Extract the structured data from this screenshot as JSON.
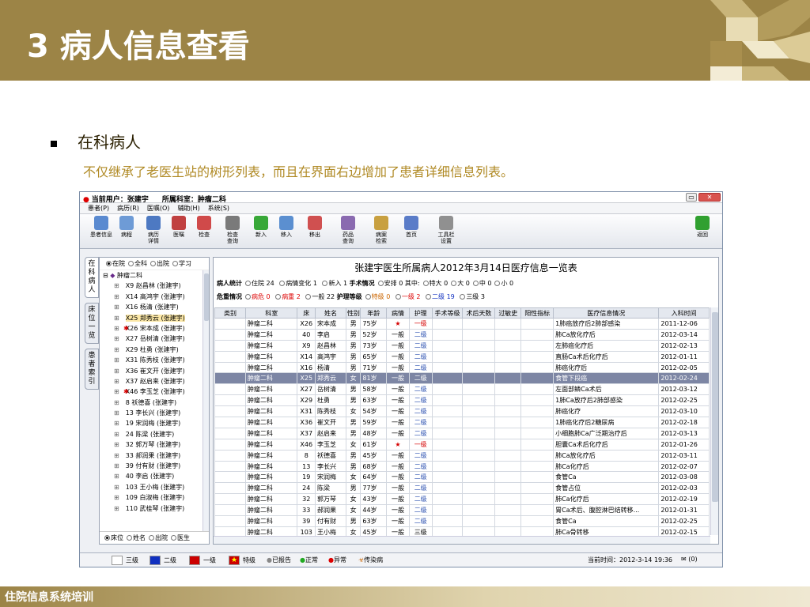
{
  "slide": {
    "title": "3 病人信息查看",
    "section": "在科病人",
    "subtitle": "不仅继承了老医生站的树形列表，而且在界面右边增加了患者详细信息列表。",
    "footer": "住院信息系统培训"
  },
  "app": {
    "title_user": "当前用户：张建宇",
    "title_dept": "所属科室：肿瘤二科",
    "menu": [
      "患者(P)",
      "病历(R)",
      "医嘱(O)",
      "辅助(H)",
      "系统(S)"
    ],
    "toolbar": [
      {
        "label": "患者信息",
        "color": "#5a8ad0"
      },
      {
        "label": "病程",
        "color": "#6e9bd6"
      },
      {
        "label": "病历\n详情",
        "color": "#4d79c2"
      },
      {
        "label": "医嘱",
        "color": "#c04040"
      },
      {
        "label": "检查",
        "color": "#d04a4a"
      },
      {
        "label": "检查\n查询",
        "color": "#7a7a7a"
      },
      {
        "label": "新入",
        "color": "#38a838"
      },
      {
        "label": "移入",
        "color": "#5b8fd0"
      },
      {
        "label": "移出",
        "color": "#d05050"
      },
      {
        "label": "药品\n查询",
        "color": "#8a6ab0"
      },
      {
        "label": "病案\n检索",
        "color": "#c8a040"
      },
      {
        "label": "首页",
        "color": "#5a7cc8"
      },
      {
        "label": "工具栏\n设置",
        "color": "#909090"
      },
      {
        "label": "返回",
        "color": "#30a030"
      }
    ],
    "vtabs": [
      "在科病人",
      "床位一览",
      "患者索引"
    ],
    "tree": {
      "radios": [
        "在院",
        "全科",
        "出院",
        "学习"
      ],
      "root": "肿瘤二科",
      "items": [
        "X9  赵昌林 (张建宇)",
        "X14 高鸿宇 (张建宇)",
        "X16 杨清 (张建宇)",
        "X25 郑秀云 (张建宇)",
        "X26 宋本成 (张建宇)",
        "X27 岳树清 (张建宇)",
        "X29 杜勇 (张建宇)",
        "X31 陈秀枝 (张建宇)",
        "X36 崔文开 (张建宇)",
        "X37 赵启来 (张建宇)",
        "X46 李玉芝 (张建宇)",
        "8  袄德喜 (张建宇)",
        "13 李长兴 (张建宇)",
        "19 宋润梅 (张建宇)",
        "24 陈梁 (张建宇)",
        "32 郭万琴 (张建宇)",
        "33 郝润果 (张建宇)",
        "39 付有财 (张建宇)",
        "40 李启 (张建宇)",
        "103 王小梅 (张建宇)",
        "109 白淑梅 (张建宇)",
        "110 武桂琴 (张建宇)"
      ],
      "bottom": [
        "床位",
        "姓名",
        "出院",
        "医生"
      ]
    },
    "right": {
      "title": "张建宇医生所属病人2012年3月14日医疗信息一览表",
      "stats1": {
        "label": "病人统计",
        "items": [
          "住院 24",
          "病情变化 1",
          "新入 1"
        ],
        "op_label": "手术情况",
        "op": "安排 0",
        "mid_label": "其中:",
        "mids": [
          "特大 0",
          "大 0",
          "中 0",
          "小 0"
        ]
      },
      "stats2": {
        "label": "危重情况",
        "items": [
          "病危 0",
          "病重 2",
          "一般 22"
        ],
        "nurse_label": "护理等级",
        "nurse": [
          "特级 0",
          "一级 2",
          "二级 19",
          "三级 3"
        ]
      },
      "columns": [
        "类别",
        "科室",
        "床",
        "姓名",
        "性别",
        "年龄",
        "病情",
        "护理",
        "手术等级",
        "术后天数",
        "过敏史",
        "阳性指标",
        "医疗信息情况",
        "入科时间"
      ],
      "rows": [
        [
          "",
          "肿瘤二科",
          "X26",
          "宋本成",
          "男",
          "75岁",
          "★",
          "一级",
          "",
          "",
          "",
          "",
          "1肺癌放疗后2肺部感染",
          "2011-12-06"
        ],
        [
          "",
          "肿瘤二科",
          "40",
          "李启",
          "男",
          "52岁",
          "一般",
          "二级",
          "",
          "",
          "",
          "",
          "肺Ca放化疗后",
          "2012-03-14"
        ],
        [
          "",
          "肿瘤二科",
          "X9",
          "赵昌林",
          "男",
          "73岁",
          "一般",
          "二级",
          "",
          "",
          "",
          "",
          "左肺癌化疗后",
          "2012-02-13"
        ],
        [
          "",
          "肿瘤二科",
          "X14",
          "高鸿宇",
          "男",
          "65岁",
          "一般",
          "二级",
          "",
          "",
          "",
          "",
          "直肠Ca术后化疗后",
          "2012-01-11"
        ],
        [
          "",
          "肿瘤二科",
          "X16",
          "杨清",
          "男",
          "71岁",
          "一般",
          "二级",
          "",
          "",
          "",
          "",
          "肺癌化疗后",
          "2012-02-05"
        ],
        [
          "",
          "肿瘤二科",
          "X25",
          "郑秀云",
          "女",
          "81岁",
          "一般",
          "二级",
          "",
          "",
          "",
          "",
          "食管下段癌",
          "2012-02-24"
        ],
        [
          "",
          "肿瘤二科",
          "X27",
          "岳树清",
          "男",
          "58岁",
          "一般",
          "二级",
          "",
          "",
          "",
          "",
          "左面部鳞Ca术后",
          "2012-03-12"
        ],
        [
          "",
          "肿瘤二科",
          "X29",
          "杜勇",
          "男",
          "63岁",
          "一般",
          "二级",
          "",
          "",
          "",
          "",
          "1肺Ca放疗后2肺部感染",
          "2012-02-25"
        ],
        [
          "",
          "肿瘤二科",
          "X31",
          "陈秀枝",
          "女",
          "54岁",
          "一般",
          "二级",
          "",
          "",
          "",
          "",
          "肺癌化疗",
          "2012-03-10"
        ],
        [
          "",
          "肿瘤二科",
          "X36",
          "崔文开",
          "男",
          "59岁",
          "一般",
          "二级",
          "",
          "",
          "",
          "",
          "1肺癌化疗后2糖尿病",
          "2012-02-18"
        ],
        [
          "",
          "肿瘤二科",
          "X37",
          "赵启来",
          "男",
          "48岁",
          "一般",
          "二级",
          "",
          "",
          "",
          "",
          "小细胞肺Ca广泛期治疗后",
          "2012-03-13"
        ],
        [
          "",
          "肿瘤二科",
          "X46",
          "李玉芝",
          "女",
          "61岁",
          "★",
          "一级",
          "",
          "",
          "",
          "",
          "胆囊Ca术后化疗后",
          "2012-01-26"
        ],
        [
          "",
          "肿瘤二科",
          "8",
          "袄德喜",
          "男",
          "45岁",
          "一般",
          "二级",
          "",
          "",
          "",
          "",
          "肺Ca放化疗后",
          "2012-03-11"
        ],
        [
          "",
          "肿瘤二科",
          "13",
          "李长兴",
          "男",
          "68岁",
          "一般",
          "二级",
          "",
          "",
          "",
          "",
          "肺Ca化疗后",
          "2012-02-07"
        ],
        [
          "",
          "肿瘤二科",
          "19",
          "宋润梅",
          "女",
          "64岁",
          "一般",
          "二级",
          "",
          "",
          "",
          "",
          "食管Ca",
          "2012-03-08"
        ],
        [
          "",
          "肿瘤二科",
          "24",
          "陈梁",
          "男",
          "77岁",
          "一般",
          "二级",
          "",
          "",
          "",
          "",
          "食管占位",
          "2012-02-03"
        ],
        [
          "",
          "肿瘤二科",
          "32",
          "郭万琴",
          "女",
          "43岁",
          "一般",
          "二级",
          "",
          "",
          "",
          "",
          "肺Ca化疗后",
          "2012-02-19"
        ],
        [
          "",
          "肿瘤二科",
          "33",
          "郝润果",
          "女",
          "44岁",
          "一般",
          "二级",
          "",
          "",
          "",
          "",
          "胃Ca术后、腹腔淋巴结转移...",
          "2012-01-31"
        ],
        [
          "",
          "肿瘤二科",
          "39",
          "付有财",
          "男",
          "63岁",
          "一般",
          "二级",
          "",
          "",
          "",
          "",
          "食管Ca",
          "2012-02-25"
        ],
        [
          "",
          "肿瘤二科",
          "103",
          "王小梅",
          "女",
          "45岁",
          "一般",
          "三级",
          "",
          "",
          "",
          "",
          "肺Ca骨转移",
          "2012-02-15"
        ]
      ]
    },
    "status": {
      "legend": [
        "三级",
        "二级",
        "一级",
        "特级",
        "已报告",
        "正常",
        "异常",
        "传染病"
      ],
      "time": "当前时间：2012-3-14 19:36",
      "mail": "(0)"
    }
  }
}
